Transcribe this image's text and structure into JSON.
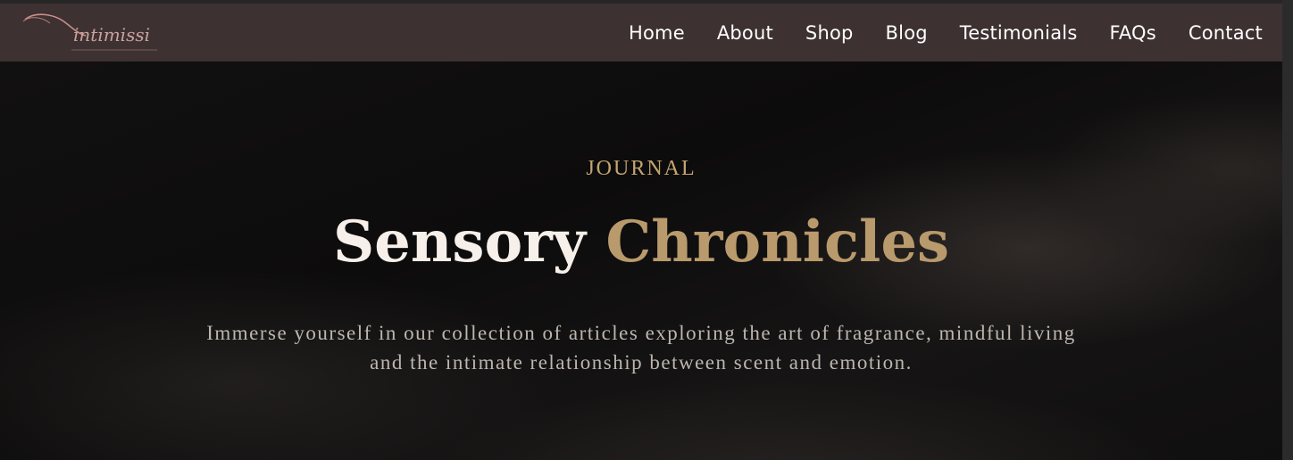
{
  "logo": {
    "text": "intimissi"
  },
  "nav": {
    "items": [
      {
        "label": "Home"
      },
      {
        "label": "About"
      },
      {
        "label": "Shop"
      },
      {
        "label": "Blog"
      },
      {
        "label": "Testimonials"
      },
      {
        "label": "FAQs"
      },
      {
        "label": "Contact"
      }
    ]
  },
  "hero": {
    "eyebrow": "JOURNAL",
    "title_part1": "Sensory",
    "title_part2": "Chronicles",
    "subtitle_line1": "Immerse yourself in our collection of articles exploring the art of fragrance, mindful living",
    "subtitle_line2": "and the intimate relationship between scent and emotion."
  },
  "colors": {
    "navbar_bg": "#3d3132",
    "accent_gold": "#c3a56f",
    "title_cream": "#f7f0ea",
    "hero_bg": "#0f0e0e"
  }
}
